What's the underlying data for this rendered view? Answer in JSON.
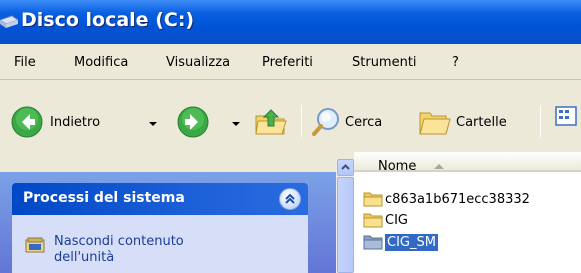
{
  "window": {
    "title": "Disco locale (C:)"
  },
  "menu": {
    "items": [
      "File",
      "Modifica",
      "Visualizza",
      "Preferiti",
      "Strumenti",
      "?"
    ]
  },
  "toolbar": {
    "back_label": "Indietro",
    "search_label": "Cerca",
    "folders_label": "Cartelle"
  },
  "task_pane": {
    "panel_title": "Processi del sistema",
    "link_label_line1": "Nascondi contenuto",
    "link_label_line2": "dell'unità"
  },
  "file_list": {
    "column_header": "Nome",
    "items": [
      {
        "name": "c863a1b671ecc38332",
        "selected": false
      },
      {
        "name": "CIG",
        "selected": false
      },
      {
        "name": "CIG_SM",
        "selected": true
      }
    ]
  },
  "colors": {
    "titlebar": "#0053d6",
    "selection": "#316ac5",
    "task_link": "#1c3d99"
  }
}
